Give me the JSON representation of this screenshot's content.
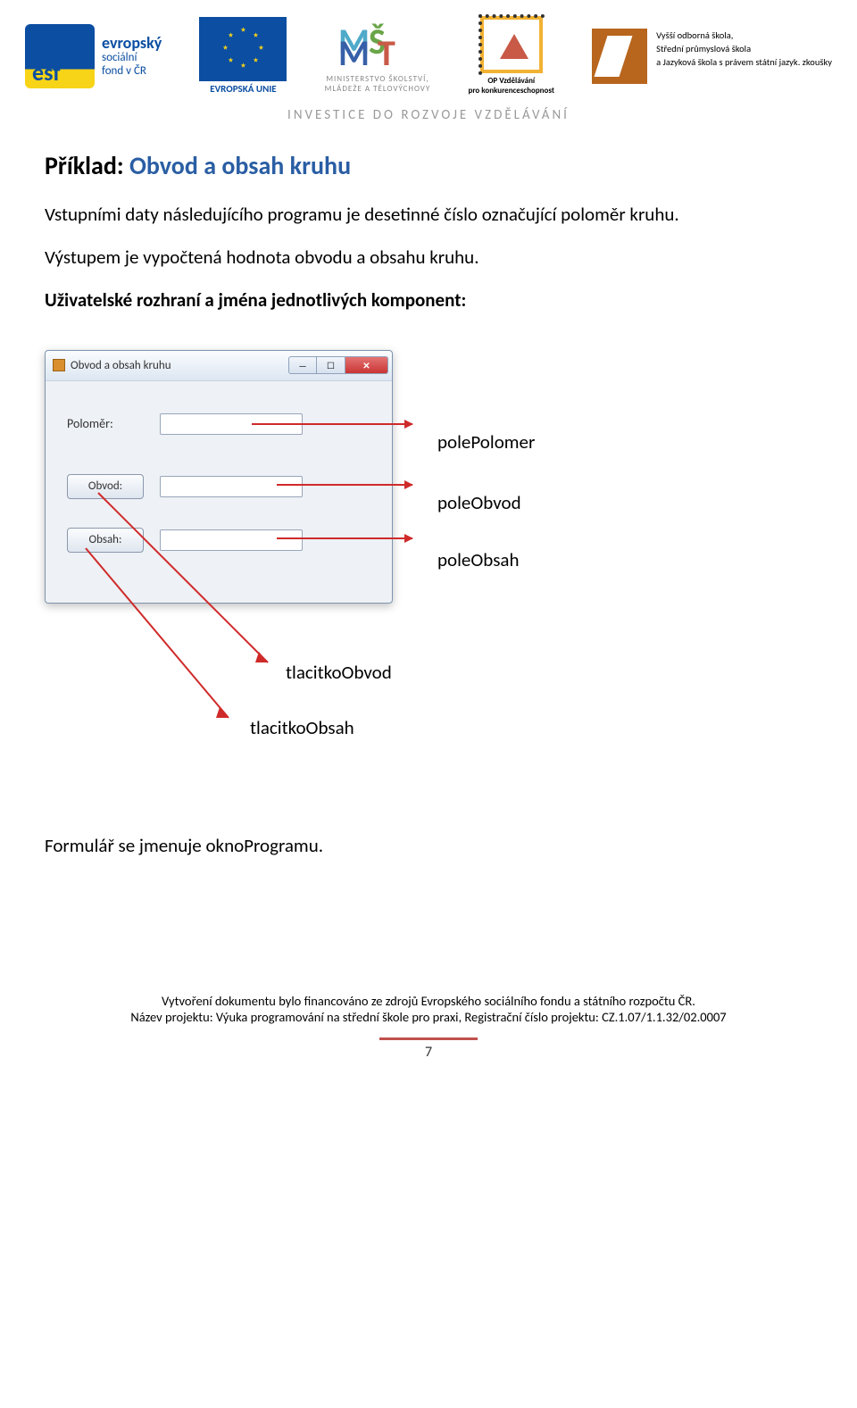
{
  "header": {
    "esf": {
      "bold": "evropský",
      "line2": "sociální",
      "line3": "fond v ČR"
    },
    "eu_label": "EVROPSKÁ UNIE",
    "msmt": {
      "line1": "MINISTERSTVO ŠKOLSTVÍ,",
      "line2": "MLÁDEŽE A TĚLOVÝCHOVY"
    },
    "op": {
      "line1": "OP Vzdělávání",
      "line2": "pro konkurenceschopnost"
    },
    "school": {
      "line1": "Vyšší odborná škola,",
      "line2": "Střední průmyslová škola",
      "line3": "a Jazyková škola s právem státní jazyk. zkoušky"
    },
    "tagline": "INVESTICE DO ROZVOJE VZDĚLÁVÁNÍ"
  },
  "title": {
    "prefix": "Příklad:",
    "text": "Obvod a obsah kruhu"
  },
  "paragraphs": {
    "p1": "Vstupními daty následujícího programu je desetinné číslo označující poloměr kruhu.",
    "p2": "Výstupem je vypočtená hodnota obvodu a obsahu kruhu.",
    "p3": "Uživatelské rozhraní a jména jednotlivých komponent:"
  },
  "window": {
    "title": "Obvod a obsah kruhu",
    "label_polomer": "Poloměr:",
    "btn_obvod": "Obvod:",
    "btn_obsah": "Obsah:"
  },
  "callouts": {
    "polePolomer": "polePolomer",
    "poleObvod": "poleObvod",
    "poleObsah": "poleObsah",
    "tlacitkoObvod": "tlacitkoObvod",
    "tlacitkoObsah": "tlacitkoObsah"
  },
  "closing": "Formulář se jmenuje oknoProgramu.",
  "footer": {
    "line1": "Vytvoření dokumentu bylo financováno ze zdrojů Evropského sociálního fondu a státního rozpočtu ČR.",
    "line2": "Název projektu: Výuka programování na střední škole pro praxi, Registrační číslo projektu: CZ.1.07/1.1.32/02.0007",
    "page": "7"
  }
}
